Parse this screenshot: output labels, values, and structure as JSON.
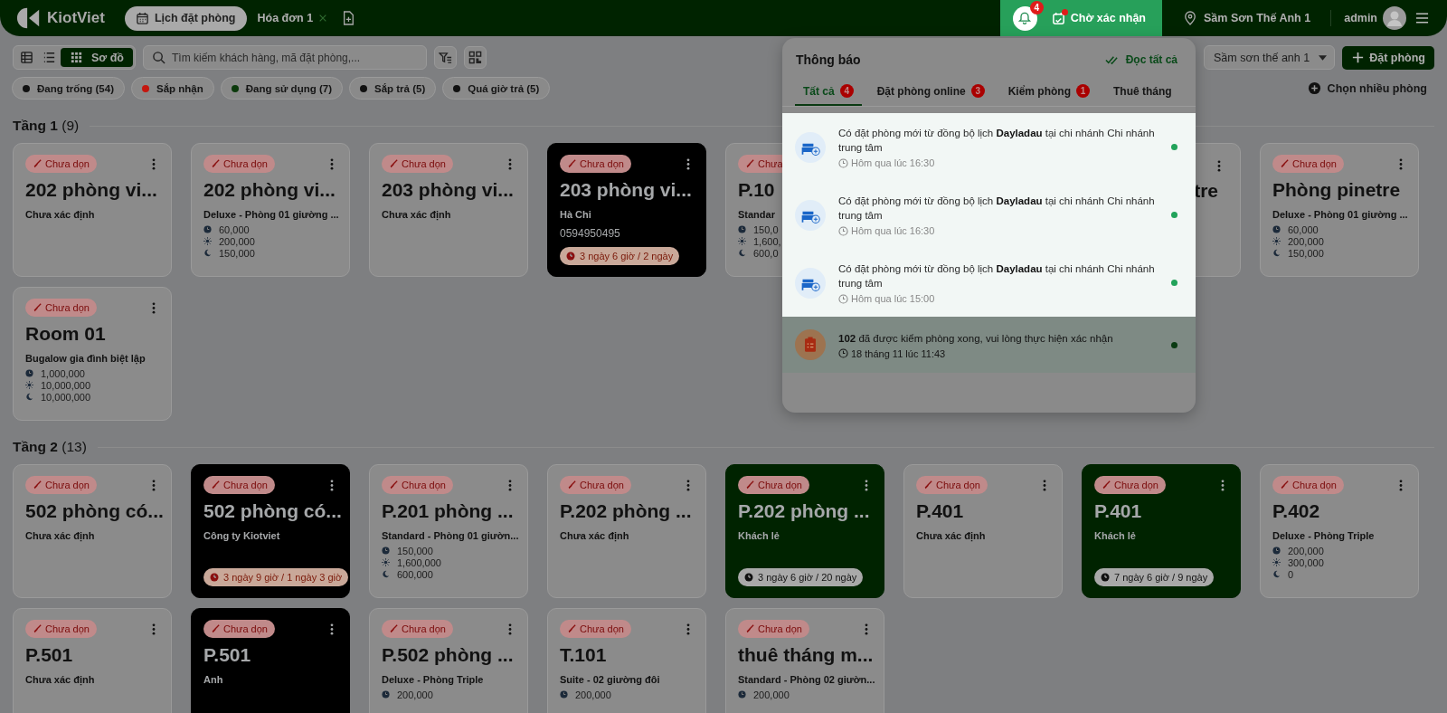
{
  "header": {
    "logo": "KiotViet",
    "tabs": [
      {
        "label": "Lịch đặt phòng",
        "selected": true,
        "closable": false
      },
      {
        "label": "Hóa đơn 1",
        "selected": false,
        "closable": true
      }
    ],
    "notification_count": "4",
    "pending": {
      "label": "Chờ xác nhận",
      "dot": true
    },
    "branch": "Sầm Sơn Thế Anh 1",
    "user": "admin"
  },
  "toolbar": {
    "views": [
      {
        "kind": "table",
        "selected": false
      },
      {
        "kind": "list",
        "selected": false
      },
      {
        "kind": "grid",
        "label": "Sơ đồ",
        "selected": true
      }
    ],
    "search": {
      "placeholder": "Tìm kiếm khách hàng, mã đặt phòng,..."
    },
    "branch_select": "Sầm sơn thế anh 1",
    "book_button": "Đặt phòng",
    "multi_select": "Chọn nhiều phòng"
  },
  "filters": [
    {
      "label": "Đang trống (54)",
      "color": "#111111"
    },
    {
      "label": "Sắp nhận",
      "color": "#c4170f"
    },
    {
      "label": "Đang sử dụng (7)",
      "color": "#0c3a0c"
    },
    {
      "label": "Sắp trả (5)",
      "color": "#111111"
    },
    {
      "label": "Quá giờ trả (5)",
      "color": "#111111"
    }
  ],
  "floors": [
    {
      "name": "Tầng 1",
      "count": "(9)",
      "rooms": [
        {
          "kind": "empty",
          "badge": "Chưa dọn",
          "title": "202 phòng vi...",
          "subtitle": "Chưa xác định"
        },
        {
          "kind": "empty",
          "badge": "Chưa dọn",
          "title": "202 phòng vi...",
          "subtitle": "Deluxe - Phòng 01 giường ...",
          "prices": [
            "60,000",
            "200,000",
            "150,000"
          ]
        },
        {
          "kind": "empty",
          "badge": "Chưa dọn",
          "title": "203 phòng vi...",
          "subtitle": "Chưa xác định"
        },
        {
          "kind": "booked",
          "badge": "Chưa dọn",
          "title": "203 phòng vi...",
          "subtitle": "Hà Chi",
          "phone": "0594950495",
          "duration": {
            "text": "3 ngày 6 giờ / 2 ngày",
            "overdue": true
          }
        },
        {
          "kind": "empty",
          "badge": "Chưa",
          "title": "P.10",
          "subtitle": "Standar",
          "prices": [
            "150,0",
            "1,600,",
            "600,0"
          ]
        },
        {
          "kind": "covered",
          "title": "tre"
        },
        {
          "kind": "empty",
          "badge": "Chưa dọn",
          "title": "Phòng pinetre",
          "subtitle": "Deluxe - Phòng 01 giường ...",
          "prices": [
            "60,000",
            "200,000",
            "150,000"
          ]
        },
        {
          "kind": "empty",
          "badge": "Chưa dọn",
          "title": "Room 01",
          "subtitle": "Bugalow gia đình biệt lập",
          "prices": [
            "1,000,000",
            "10,000,000",
            "10,000,000"
          ]
        }
      ]
    },
    {
      "name": "Tầng 2",
      "count": "(13)",
      "rooms": [
        {
          "kind": "empty",
          "badge": "Chưa dọn",
          "title": "502 phòng có...",
          "subtitle": "Chưa xác định"
        },
        {
          "kind": "booked",
          "badge": "Chưa dọn",
          "title": "502 phòng có...",
          "subtitle": "Công ty Kiotviet",
          "duration": {
            "text": "3 ngày 9 giờ / 1 ngày 3 giờ",
            "overdue": true
          }
        },
        {
          "kind": "empty",
          "badge": "Chưa dọn",
          "title": "P.201 phòng ...",
          "subtitle": "Standard - Phòng 01 giườn...",
          "prices": [
            "150,000",
            "1,600,000",
            "600,000"
          ]
        },
        {
          "kind": "empty",
          "badge": "Chưa dọn",
          "title": "P.202 phòng ...",
          "subtitle": "Chưa xác định"
        },
        {
          "kind": "using",
          "badge": "Chưa dọn",
          "title": "P.202 phòng ...",
          "subtitle": "Khách lẻ",
          "duration": {
            "text": "3 ngày 6 giờ / 20 ngày",
            "overdue": false
          }
        },
        {
          "kind": "empty",
          "badge": "Chưa dọn",
          "title": "P.401",
          "subtitle": "Chưa xác định"
        },
        {
          "kind": "using",
          "badge": "Chưa dọn",
          "title": "P.401",
          "subtitle": "Khách lẻ",
          "duration": {
            "text": "7 ngày 6 giờ / 9 ngày",
            "overdue": false
          }
        },
        {
          "kind": "empty",
          "badge": "Chưa dọn",
          "title": "P.402",
          "subtitle": "Deluxe - Phòng Triple",
          "prices": [
            "200,000",
            "300,000",
            "0"
          ]
        },
        {
          "kind": "empty",
          "badge": "Chưa dọn",
          "title": "P.501",
          "subtitle": "Chưa xác định"
        },
        {
          "kind": "booked",
          "badge": "Chưa dọn",
          "title": "P.501",
          "subtitle": "Anh"
        },
        {
          "kind": "empty",
          "badge": "Chưa dọn",
          "title": "P.502 phòng ...",
          "subtitle": "Deluxe - Phòng Triple",
          "prices": [
            "200,000"
          ]
        },
        {
          "kind": "empty",
          "badge": "Chưa dọn",
          "title": "T.101",
          "subtitle": "Suite - 02 giường đôi",
          "prices": [
            "200,000"
          ]
        },
        {
          "kind": "empty",
          "badge": "Chưa dọn",
          "title": "thuê tháng m...",
          "subtitle": "Standard - Phòng 02 giườn...",
          "prices": [
            "200,000"
          ]
        }
      ]
    }
  ],
  "notifications": {
    "title": "Thông báo",
    "read_all": "Đọc tất cả",
    "tabs": [
      {
        "label": "Tất cả",
        "count": "4",
        "selected": true
      },
      {
        "label": "Đặt phòng online",
        "count": "3",
        "selected": false
      },
      {
        "label": "Kiểm phòng",
        "count": "1",
        "selected": false
      },
      {
        "label": "Thuê tháng",
        "selected": false
      }
    ],
    "items": [
      {
        "kind": "booking",
        "highlighted": true,
        "text": "Có đặt phòng mới từ đồng bộ lịch **Dayladau** tại chi nhánh Chi nhánh trung tâm",
        "time": "Hôm qua lúc 16:30",
        "unread": true
      },
      {
        "kind": "booking",
        "highlighted": true,
        "text": "Có đặt phòng mới từ đồng bộ lịch **Dayladau** tại chi nhánh Chi nhánh trung tâm",
        "time": "Hôm qua lúc 16:30",
        "unread": true
      },
      {
        "kind": "booking",
        "highlighted": true,
        "text": "Có đặt phòng mới từ đồng bộ lịch **Dayladau** tại chi nhánh Chi nhánh trung tâm",
        "time": "Hôm qua lúc 15:00",
        "unread": true
      },
      {
        "kind": "inspection",
        "highlighted": false,
        "text": "**102** đã được kiểm phòng xong, vui lòng thực hiện xác nhận",
        "time": "18 tháng 11 lúc 11:43",
        "unread": true
      }
    ]
  }
}
